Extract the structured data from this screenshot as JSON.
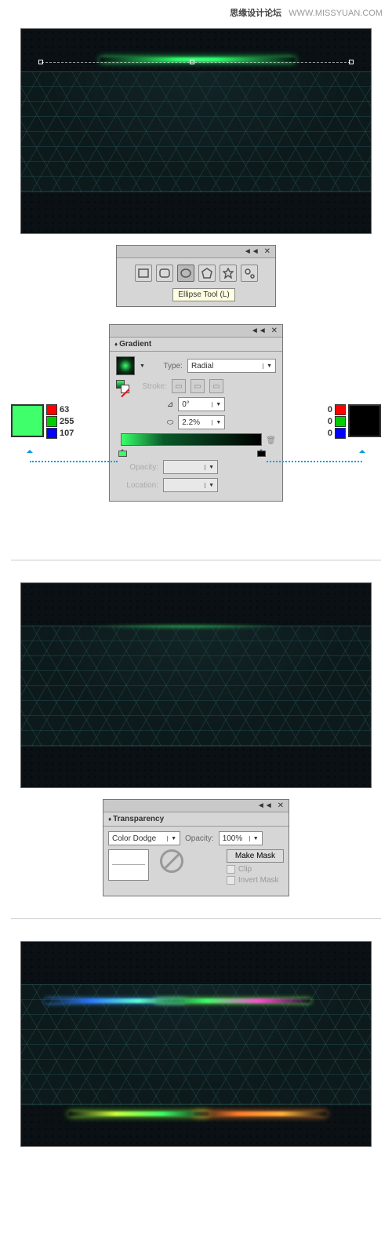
{
  "watermark": {
    "brand": "思缘设计论坛",
    "url": "WWW.MISSYUAN.COM"
  },
  "tools_panel": {
    "tooltip": "Ellipse Tool (L)"
  },
  "gradient_panel": {
    "title": "Gradient",
    "type_label": "Type:",
    "type_value": "Radial",
    "stroke_label": "Stroke:",
    "angle_label": "0°",
    "aspect_label": "2.2%",
    "opacity_label": "Opacity:",
    "location_label": "Location:"
  },
  "color_left": {
    "hex": "#3FFF6B",
    "r": "63",
    "g": "255",
    "b": "107"
  },
  "color_right": {
    "hex": "#000000",
    "r": "0",
    "g": "0",
    "b": "0"
  },
  "transparency_panel": {
    "title": "Transparency",
    "blend_mode": "Color Dodge",
    "opacity_label": "Opacity:",
    "opacity_value": "100%",
    "make_mask": "Make Mask",
    "clip": "Clip",
    "invert": "Invert Mask"
  },
  "chart_data": {
    "type": "gradient",
    "mode": "Radial",
    "angle": 0,
    "aspect_ratio_pct": 2.2,
    "stops": [
      {
        "position": 0,
        "color": {
          "r": 63,
          "g": 255,
          "b": 107
        }
      },
      {
        "position": 100,
        "color": {
          "r": 0,
          "g": 0,
          "b": 0
        }
      }
    ],
    "blend_mode": "Color Dodge",
    "opacity_pct": 100
  }
}
